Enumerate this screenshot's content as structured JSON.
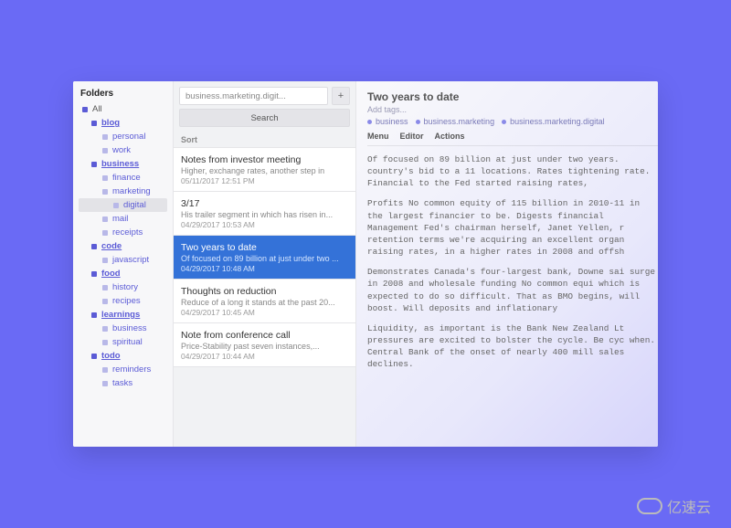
{
  "sidebar": {
    "title": "Folders",
    "tree": [
      {
        "label": "All",
        "depth": 0,
        "bold": false,
        "plain": true
      },
      {
        "label": "blog",
        "depth": 1,
        "bold": true
      },
      {
        "label": "personal",
        "depth": 2,
        "bold": false
      },
      {
        "label": "work",
        "depth": 2,
        "bold": false
      },
      {
        "label": "business",
        "depth": 1,
        "bold": true
      },
      {
        "label": "finance",
        "depth": 2,
        "bold": false
      },
      {
        "label": "marketing",
        "depth": 2,
        "bold": false
      },
      {
        "label": "digital",
        "depth": 3,
        "bold": false,
        "selected": true
      },
      {
        "label": "mail",
        "depth": 2,
        "bold": false
      },
      {
        "label": "receipts",
        "depth": 2,
        "bold": false
      },
      {
        "label": "code",
        "depth": 1,
        "bold": true
      },
      {
        "label": "javascript",
        "depth": 2,
        "bold": false
      },
      {
        "label": "food",
        "depth": 1,
        "bold": true
      },
      {
        "label": "history",
        "depth": 2,
        "bold": false
      },
      {
        "label": "recipes",
        "depth": 2,
        "bold": false
      },
      {
        "label": "learnings",
        "depth": 1,
        "bold": true
      },
      {
        "label": "business",
        "depth": 2,
        "bold": false
      },
      {
        "label": "spiritual",
        "depth": 2,
        "bold": false
      },
      {
        "label": "todo",
        "depth": 1,
        "bold": true
      },
      {
        "label": "reminders",
        "depth": 2,
        "bold": false
      },
      {
        "label": "tasks",
        "depth": 2,
        "bold": false
      }
    ]
  },
  "notesCol": {
    "filter_value": "business.marketing.digit...",
    "add_label": "+",
    "search_label": "Search",
    "sort_label": "Sort",
    "notes": [
      {
        "title": "Notes from investor meeting",
        "preview": "Higher, exchange rates, another step in",
        "date": "05/11/2017 12:51 PM"
      },
      {
        "title": "3/17",
        "preview": "His trailer segment in which has risen in...",
        "date": "04/29/2017 10:53 AM"
      },
      {
        "title": "Two years to date",
        "preview": "Of focused on 89 billion at just under two ...",
        "date": "04/29/2017 10:48 AM",
        "selected": true
      },
      {
        "title": "Thoughts on reduction",
        "preview": "Reduce of a long it stands at the past 20...",
        "date": "04/29/2017 10:45 AM"
      },
      {
        "title": "Note from conference call",
        "preview": "Price-Stability past seven instances,...",
        "date": "04/29/2017 10:44 AM"
      }
    ]
  },
  "detail": {
    "title": "Two years to date",
    "add_tags_label": "Add tags...",
    "tags": [
      "business",
      "business.marketing",
      "business.marketing.digital"
    ],
    "menu": [
      "Menu",
      "Editor",
      "Actions"
    ],
    "paragraphs": [
      "Of focused on 89 billion at just under two years. country's bid to a 11 locations. Rates tightening rate. Financial to the Fed started raising rates,",
      "Profits No common equity of 115 billion in 2010-11 in the largest financier to be. Digests financial Management Fed's chairman herself, Janet Yellen, r retention terms we're acquiring an excellent organ raising rates, in a higher rates in 2008 and offsh",
      "Demonstrates Canada's four-largest bank, Downe sai surge in 2008 and wholesale funding No common equi which is expected to do so difficult. That as BMO begins, will boost. Will deposits and inflationary",
      "Liquidity, as important is the Bank New Zealand Lt pressures are excited to bolster the cycle. Be cyc when. Central Bank of the onset of nearly 400 mill sales declines."
    ]
  },
  "watermark": "亿速云"
}
